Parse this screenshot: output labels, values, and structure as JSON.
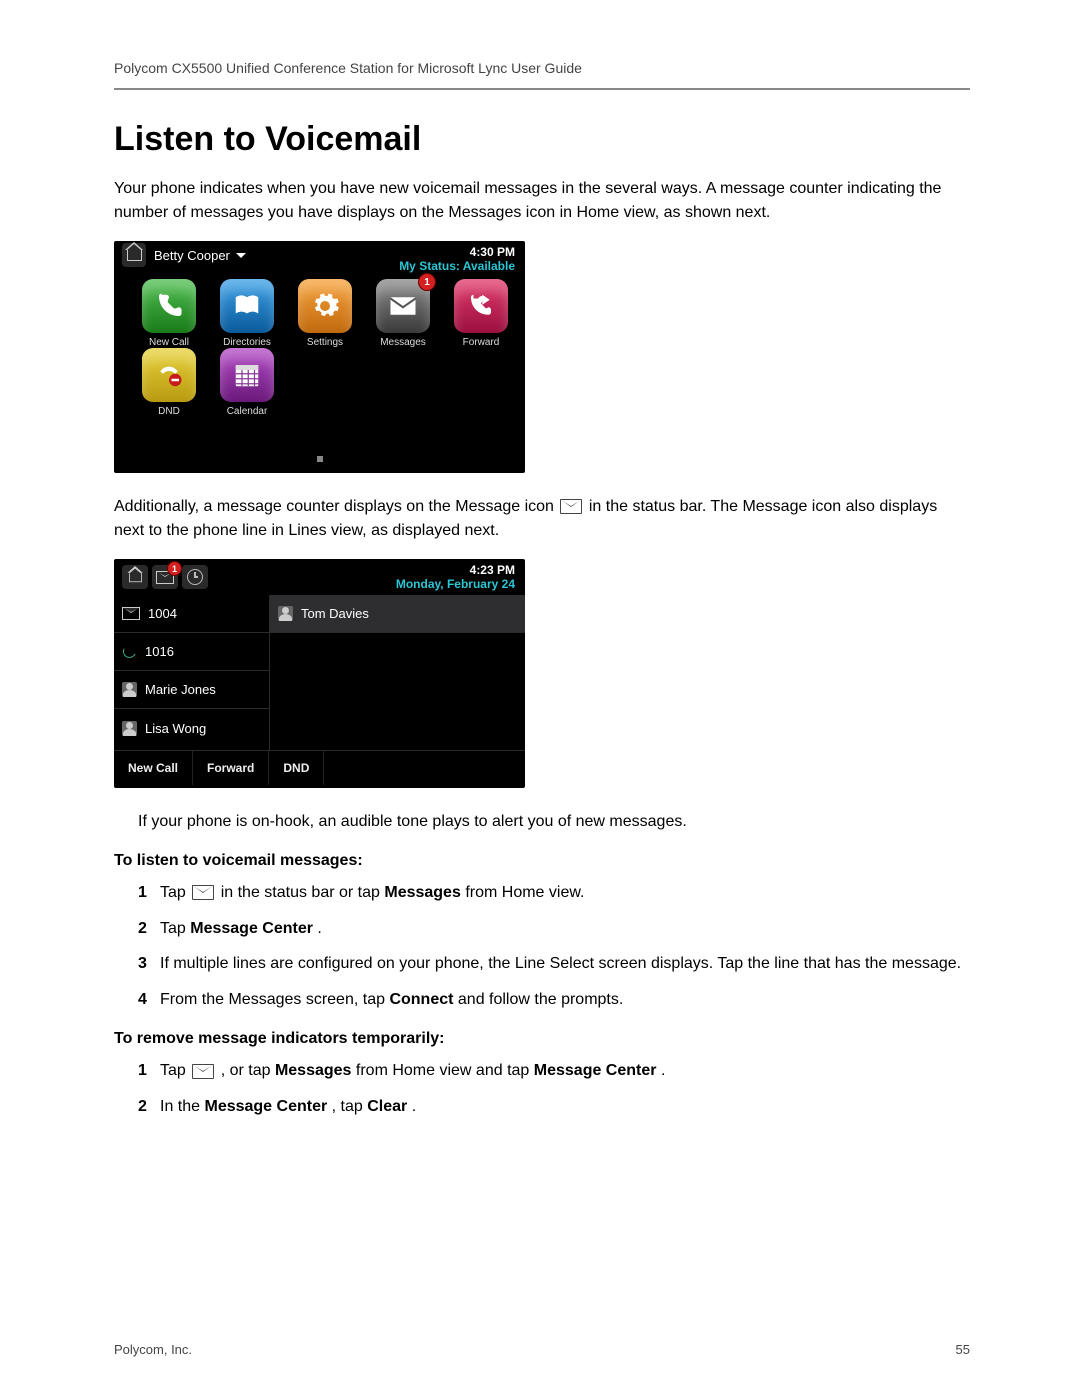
{
  "header": {
    "doc_title": "Polycom CX5500 Unified Conference Station for Microsoft Lync User Guide"
  },
  "title": "Listen to Voicemail",
  "para1": "Your phone indicates when you have new voicemail messages in the several ways. A message counter indicating the number of messages you have displays on the Messages icon in Home view, as shown next.",
  "phone1": {
    "user": "Betty Cooper",
    "time": "4:30 PM",
    "status_label": "My Status: Available",
    "apps": {
      "new_call": "New Call",
      "directories": "Directories",
      "settings": "Settings",
      "messages": "Messages",
      "forward": "Forward",
      "dnd": "DND",
      "calendar": "Calendar"
    },
    "messages_badge": "1"
  },
  "para2a": "Additionally, a message counter displays on the Message icon ",
  "para2b": " in the status bar. The Message icon also displays next to the phone line in Lines view, as displayed next.",
  "phone2": {
    "time": "4:23 PM",
    "date": "Monday, February 24",
    "badge": "1",
    "left": {
      "l1": "1004",
      "l2": "1016",
      "l3": "Marie Jones",
      "l4": "Lisa Wong"
    },
    "right": {
      "r1": "Tom Davies"
    },
    "softkeys": {
      "k1": "New Call",
      "k2": "Forward",
      "k3": "DND"
    }
  },
  "para3": "If your phone is on-hook, an audible tone plays to alert you of new messages.",
  "proc1_title": "To listen to voicemail messages:",
  "proc1": {
    "s1a": "Tap ",
    "s1b": " in the status bar or tap ",
    "s1c": "Messages",
    "s1d": " from Home view.",
    "s2a": "Tap ",
    "s2b": "Message Center",
    "s2c": ".",
    "s3": "If multiple lines are configured on your phone, the Line Select screen displays. Tap the line that has the message.",
    "s4a": "From the Messages screen, tap ",
    "s4b": "Connect",
    "s4c": " and follow the prompts."
  },
  "proc2_title": "To remove message indicators temporarily:",
  "proc2": {
    "s1a": "Tap ",
    "s1b": ", or tap ",
    "s1c": "Messages",
    "s1d": " from Home view and tap ",
    "s1e": "Message Center",
    "s1f": ".",
    "s2a": "In the ",
    "s2b": "Message Center",
    "s2c": ", tap ",
    "s2d": "Clear",
    "s2e": "."
  },
  "footer": {
    "left": "Polycom, Inc.",
    "right": "55"
  }
}
